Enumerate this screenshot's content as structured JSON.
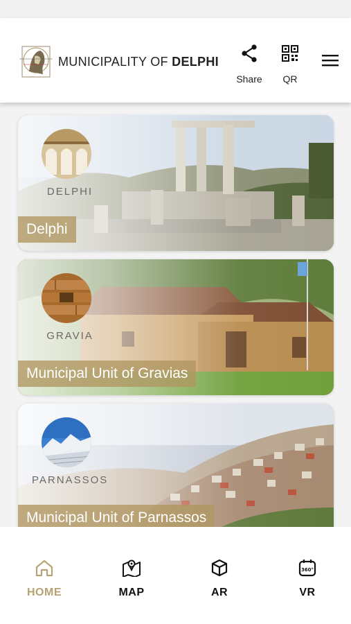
{
  "header": {
    "logo_text_prefix": "MUNICIPALITY OF ",
    "logo_text_bold": "DELPHI",
    "share_label": "Share",
    "qr_label": "QR"
  },
  "cards": [
    {
      "caption": "Delphi",
      "emblem_name": "DELPHI"
    },
    {
      "caption": "Municipal Unit of Gravias",
      "emblem_name": "GRAVIA"
    },
    {
      "caption": "Municipal Unit of Parnassos",
      "emblem_name": "PARNASSOS"
    }
  ],
  "tabs": [
    {
      "label": "HOME",
      "icon": "home-icon",
      "active": true
    },
    {
      "label": "MAP",
      "icon": "map-icon",
      "active": false
    },
    {
      "label": "AR",
      "icon": "cube-icon",
      "active": false
    },
    {
      "label": "VR",
      "icon": "vr-360-icon",
      "active": false
    }
  ],
  "colors": {
    "accent": "#b7a274",
    "caption_bg": "#b09660",
    "header_bg": "#ffffff"
  }
}
